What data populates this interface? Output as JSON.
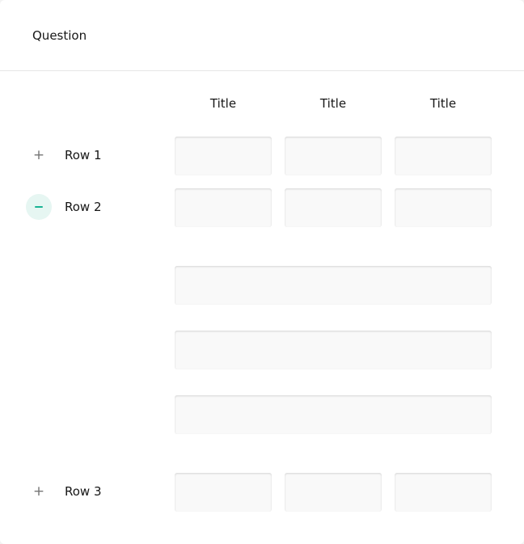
{
  "question": {
    "title": "Question"
  },
  "columns": [
    "Title",
    "Title",
    "Title"
  ],
  "rows": [
    {
      "label": "Row 1",
      "expanded": false,
      "icon": "plus-icon",
      "toggle_glyph": "+"
    },
    {
      "label": "Row 2",
      "expanded": true,
      "icon": "minus-icon",
      "toggle_glyph": ""
    },
    {
      "label": "Row 3",
      "expanded": false,
      "icon": "plus-icon",
      "toggle_glyph": "+"
    }
  ],
  "detail_panel": {
    "row": "Row 2",
    "fields": [
      "",
      "",
      ""
    ]
  },
  "cells": {
    "row1": [
      "",
      "",
      ""
    ],
    "row2": [
      "",
      "",
      ""
    ],
    "row3": [
      "",
      "",
      ""
    ]
  },
  "colors": {
    "accent": "#19b394",
    "accent_light": "#e6f6f2",
    "input_bg": "#f9f9f9",
    "divider": "#e6e6e6"
  }
}
